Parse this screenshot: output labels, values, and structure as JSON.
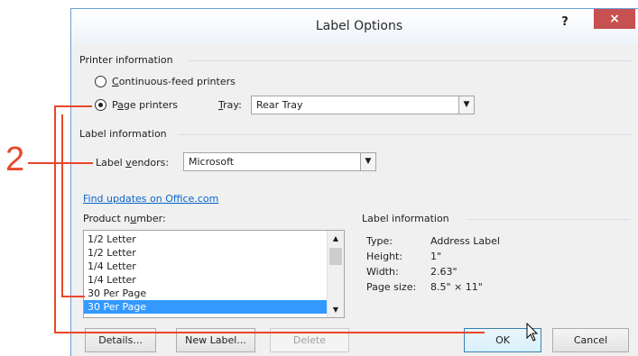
{
  "dialog": {
    "title": "Label Options",
    "help_label": "?",
    "close_label": "×"
  },
  "printer_info": {
    "heading": "Printer information",
    "continuous_label_prefix": "",
    "continuous_label_u": "C",
    "continuous_label_rest": "ontinuous-feed printers",
    "page_label_prefix": "P",
    "page_label_u": "a",
    "page_label_rest": "ge printers",
    "tray_label_u": "T",
    "tray_label_rest": "ray:",
    "tray_value": "Rear Tray",
    "selected": "page"
  },
  "label_info": {
    "heading": "Label information",
    "vendor_label_prefix": "Label ",
    "vendor_label_u": "v",
    "vendor_label_rest": "endors:",
    "vendor_value": "Microsoft",
    "updates_link": "Find updates on Office.com",
    "product_label_prefix": "Product n",
    "product_label_u": "u",
    "product_label_rest": "mber:"
  },
  "product_list": {
    "items": [
      "1/2 Letter",
      "1/2 Letter",
      "1/4 Letter",
      "1/4 Letter",
      "30 Per Page",
      "30 Per Page"
    ],
    "selected_index": 5
  },
  "label_details": {
    "heading": "Label information",
    "rows": [
      {
        "key": "Type:",
        "value": "Address Label"
      },
      {
        "key": "Height:",
        "value": "1\""
      },
      {
        "key": "Width:",
        "value": "2.63\""
      },
      {
        "key": "Page size:",
        "value": "8.5\" × 11\""
      }
    ]
  },
  "buttons": {
    "details": "Details...",
    "new_label": "New Label...",
    "delete": "Delete",
    "ok": "OK",
    "cancel": "Cancel"
  },
  "annotation": {
    "callout_number": "2",
    "color": "#e8472b"
  },
  "colors": {
    "selection": "#3399ff",
    "link": "#0b65c9",
    "close_button": "#c75050"
  }
}
